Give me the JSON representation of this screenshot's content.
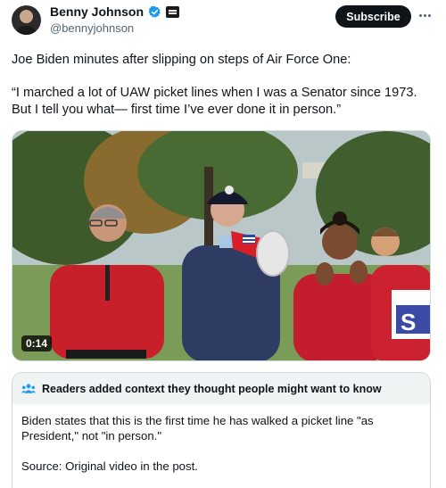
{
  "author": {
    "display_name": "Benny Johnson",
    "handle": "@bennyjohnson",
    "avatar_icon": "profile-photo",
    "verified_icon": "verified-badge-icon",
    "affiliation_icon": "affiliate-badge-icon"
  },
  "actions": {
    "subscribe_label": "Subscribe",
    "more_icon": "more-options-icon"
  },
  "tweet": {
    "line1": "Joe Biden minutes after slipping on steps of Air Force One:",
    "quote": "“I marched a lot of UAW picket lines when I was a Senator since 1973. But I tell you what— first time I’ve ever done it in person.”"
  },
  "video": {
    "duration": "0:14",
    "sign_text": "S"
  },
  "community_note": {
    "icon": "people-icon",
    "title": "Readers added context they thought people might want to know",
    "body": "Biden states that this is the first time he has walked a picket line \"as President,\" not \"in person.\"",
    "source": "Source: Original video in the post."
  },
  "colors": {
    "accent": "#1d9bf0",
    "text_primary": "#0f1419",
    "text_secondary": "#536471",
    "notes_header_bg": "#eff3f4",
    "shirt_red": "#c8202b"
  }
}
